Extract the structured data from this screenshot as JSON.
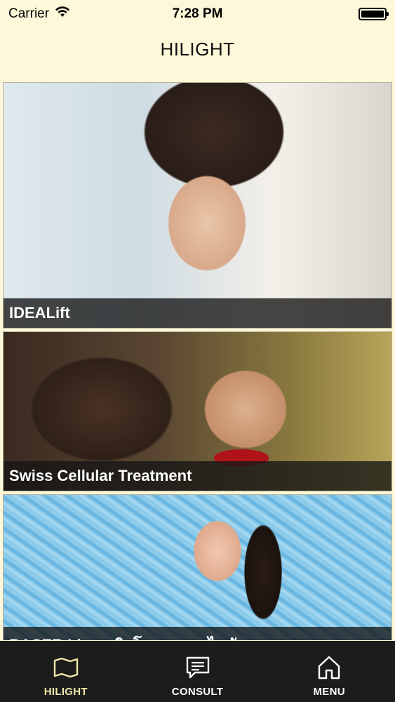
{
  "status_bar": {
    "carrier": "Carrier",
    "time": "7:28 PM"
  },
  "nav": {
    "title": "HILIGHT"
  },
  "feed": {
    "items": [
      {
        "caption": "IDEALift"
      },
      {
        "caption": "Swiss Cellular Treatment"
      },
      {
        "caption": "BASER Lipo พลิกโฉมการลดไขมัน"
      }
    ]
  },
  "tab_bar": {
    "tabs": [
      {
        "label": "HILIGHT",
        "icon": "map-icon",
        "active": true
      },
      {
        "label": "CONSULT",
        "icon": "chat-icon",
        "active": false
      },
      {
        "label": "MENU",
        "icon": "home-icon",
        "active": false
      }
    ]
  },
  "colors": {
    "background": "#fdf8d9",
    "tab_bar": "#1c1c1c",
    "active_tab": "#f1e8a8",
    "caption_bg": "#141414"
  }
}
